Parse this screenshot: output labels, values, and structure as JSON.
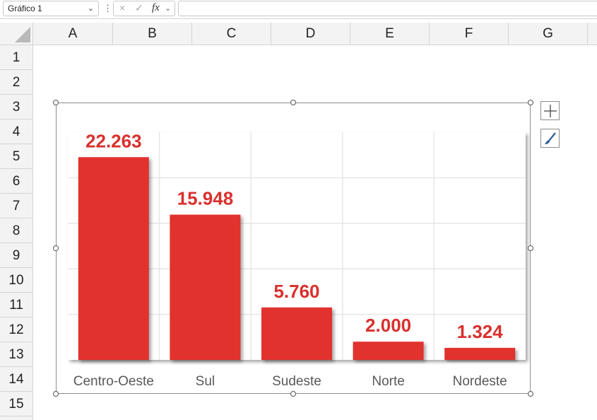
{
  "formula_bar": {
    "name_box": "Gráfico 1",
    "separator": "⋮",
    "cancel_icon": "×",
    "confirm_icon": "✓",
    "fx_label": "fx",
    "formula": ""
  },
  "columns": [
    "A",
    "B",
    "C",
    "D",
    "E",
    "F",
    "G"
  ],
  "rows": [
    "1",
    "2",
    "3",
    "4",
    "5",
    "6",
    "7",
    "8",
    "9",
    "10",
    "11",
    "12",
    "13",
    "14",
    "15"
  ],
  "chart_data": {
    "type": "bar",
    "categories": [
      "Centro-Oeste",
      "Sul",
      "Sudeste",
      "Norte",
      "Nordeste"
    ],
    "values": [
      22263,
      15948,
      5760,
      2000,
      1324
    ],
    "data_labels": [
      "22.263",
      "15.948",
      "5.760",
      "2.000",
      "1.324"
    ],
    "ylim": [
      0,
      25000
    ],
    "grid": true,
    "bar_color": "#e1302d",
    "label_color": "#d9302d",
    "title": "",
    "xlabel": "",
    "ylabel": ""
  },
  "chart_tools": {
    "elements_icon": "plus-icon",
    "styles_icon": "brush-icon"
  }
}
